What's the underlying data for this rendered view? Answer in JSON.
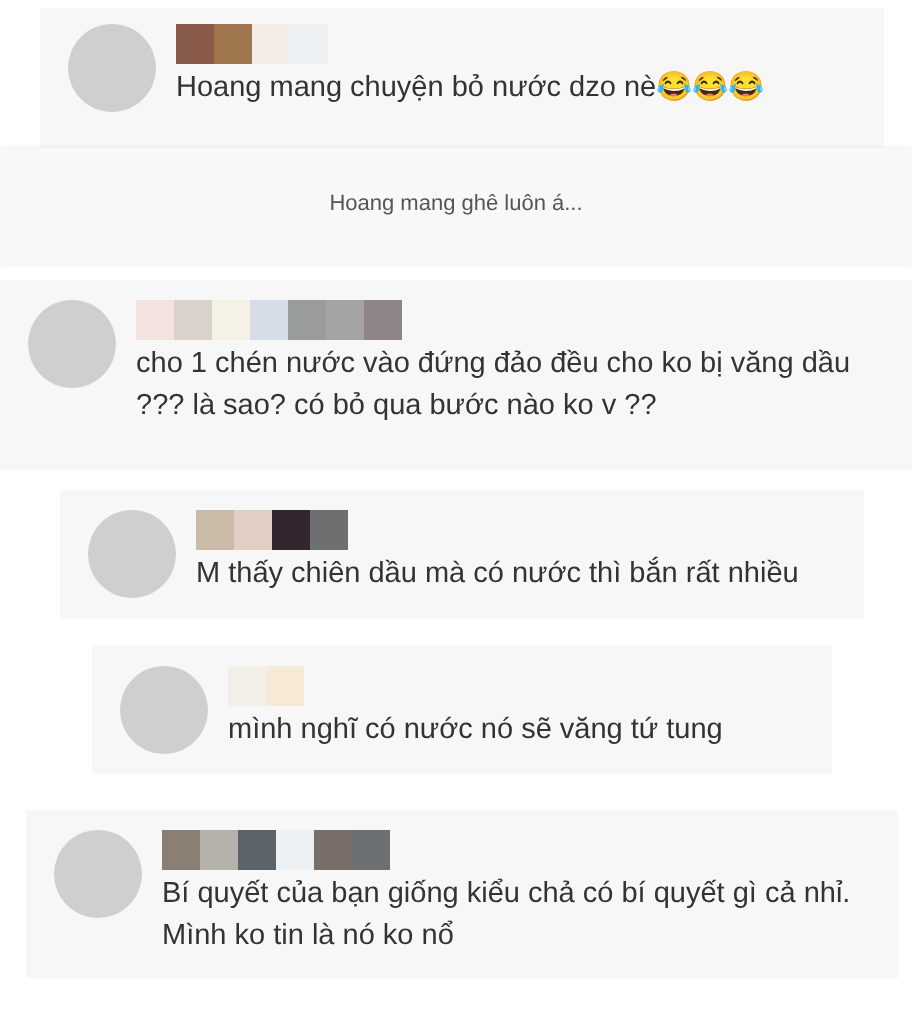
{
  "comments": [
    {
      "kind": "comment",
      "text": "Hoang mang chuyện bỏ nước dzo nè😂😂😂"
    },
    {
      "kind": "caption",
      "text": "Hoang mang ghê luôn á..."
    },
    {
      "kind": "comment",
      "text": "cho 1 chén nước vào đứng đảo đều cho ko bị văng dầu ??? là sao? có bỏ qua bước nào ko v ??"
    },
    {
      "kind": "comment",
      "text": "M thấy chiên dầu mà có nước thì bắn rất nhiều"
    },
    {
      "kind": "comment",
      "text": "mình nghĩ có nước nó sẽ văng tứ tung"
    },
    {
      "kind": "comment",
      "text": "Bí quyết của bạn giống kiểu chả có bí quyết gì cả nhỉ. Mình ko tin là nó ko nổ"
    }
  ]
}
